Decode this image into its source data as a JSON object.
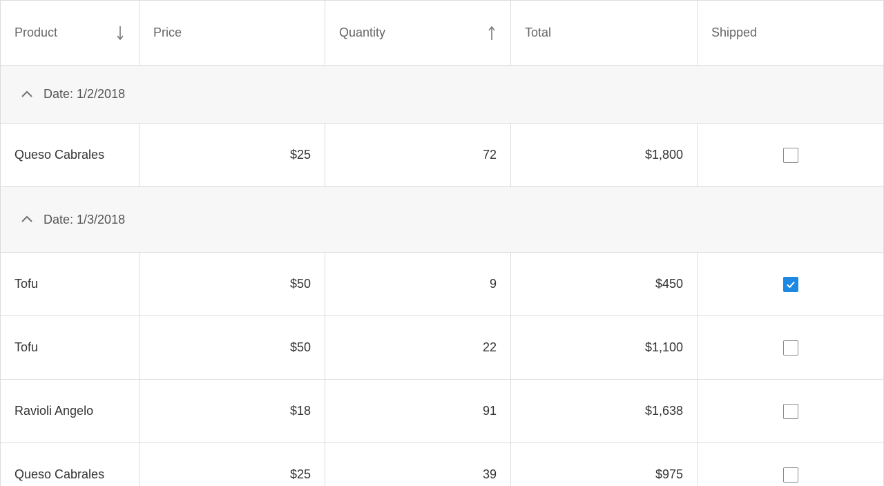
{
  "columns": [
    {
      "label": "Product",
      "sort": "descending"
    },
    {
      "label": "Price",
      "sort": ""
    },
    {
      "label": "Quantity",
      "sort": "ascending"
    },
    {
      "label": "Total",
      "sort": ""
    },
    {
      "label": "Shipped",
      "sort": ""
    }
  ],
  "groups": [
    {
      "label": "Date: 1/2/2018",
      "expanded": true,
      "rows": [
        {
          "product": "Queso Cabrales",
          "price": "$25",
          "quantity": "72",
          "total": "$1,800",
          "shipped": false
        }
      ]
    },
    {
      "label": "Date: 1/3/2018",
      "expanded": true,
      "rows": [
        {
          "product": "Tofu",
          "price": "$50",
          "quantity": "9",
          "total": "$450",
          "shipped": true
        },
        {
          "product": "Tofu",
          "price": "$50",
          "quantity": "22",
          "total": "$1,100",
          "shipped": false
        },
        {
          "product": "Ravioli Angelo",
          "price": "$18",
          "quantity": "91",
          "total": "$1,638",
          "shipped": false
        },
        {
          "product": "Queso Cabrales",
          "price": "$25",
          "quantity": "39",
          "total": "$975",
          "shipped": false
        }
      ]
    }
  ],
  "colors": {
    "accent": "#1e88e5",
    "group_background": "#f7f7f7",
    "border": "#dcdcdc"
  },
  "icons": {
    "sort_descending": "arrow-down-icon",
    "sort_ascending": "arrow-up-icon",
    "group_toggle": "chevron-up-icon",
    "check": "checkmark-icon"
  }
}
